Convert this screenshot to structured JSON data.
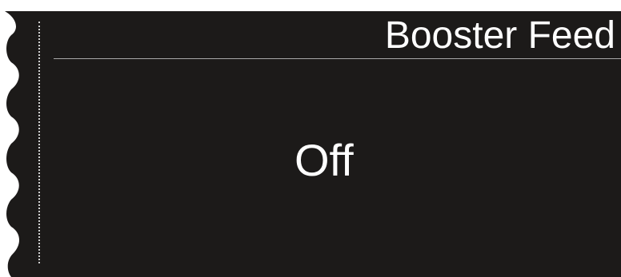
{
  "panel": {
    "title": "Booster Feed",
    "state": "Off",
    "background_color": "#1c1a19",
    "text_color": "#ffffff"
  }
}
